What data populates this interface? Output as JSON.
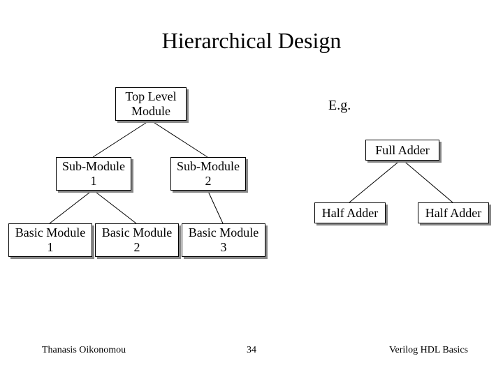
{
  "title": "Hierarchical Design",
  "eg_label": "E.g.",
  "left_tree": {
    "top": "Top Level\nModule",
    "sub1": "Sub-Module\n1",
    "sub2": "Sub-Module\n2",
    "basic1": "Basic Module\n1",
    "basic2": "Basic Module\n2",
    "basic3": "Basic Module\n3"
  },
  "right_tree": {
    "top": "Full Adder",
    "left": "Half Adder",
    "right": "Half Adder"
  },
  "footer": {
    "author": "Thanasis Oikonomou",
    "page": "34",
    "topic": "Verilog HDL Basics"
  }
}
